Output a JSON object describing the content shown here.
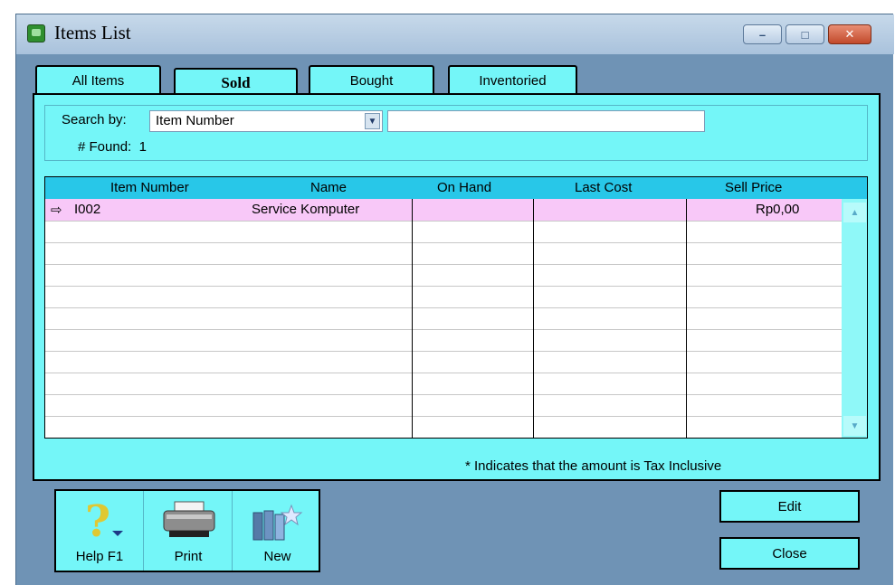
{
  "window": {
    "title": "Items List",
    "controls": {
      "minimize": "–",
      "maximize": "□",
      "close": "✕"
    }
  },
  "tabs": [
    {
      "label": "All Items",
      "active": false
    },
    {
      "label": "Sold",
      "active": true
    },
    {
      "label": "Bought",
      "active": false
    },
    {
      "label": "Inventoried",
      "active": false
    }
  ],
  "search": {
    "label": "Search by:",
    "field_value": "Item Number",
    "input_value": "",
    "found_label": "# Found:",
    "found_count": "1"
  },
  "table": {
    "columns": [
      "Item Number",
      "Name",
      "On Hand",
      "Last Cost",
      "Sell Price"
    ],
    "rows": [
      {
        "marker": "⇨",
        "item_number": "I002",
        "name": "Service Komputer",
        "on_hand": "",
        "last_cost": "",
        "sell_price": "Rp0,00"
      }
    ]
  },
  "tax_note": "* Indicates that the amount is Tax Inclusive",
  "toolbar": {
    "help_label": "Help F1",
    "print_label": "Print",
    "new_label": "New"
  },
  "buttons": {
    "edit_label": "Edit",
    "close_label": "Close"
  },
  "colors": {
    "panel": "#74f6f8",
    "header": "#28c7e8",
    "selected_row": "#f8c8f8",
    "frame": "#6f93b5"
  }
}
